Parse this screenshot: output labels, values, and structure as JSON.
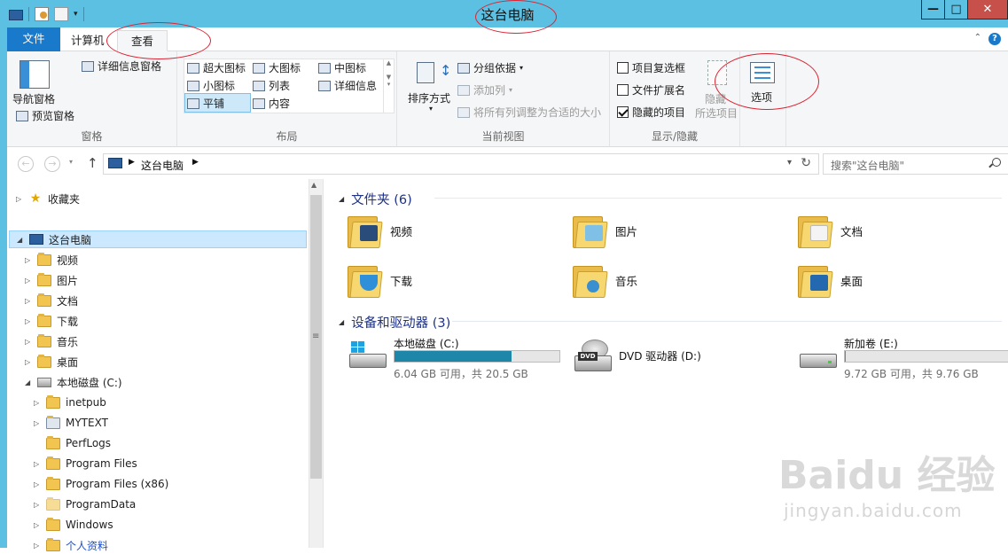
{
  "title": "这台电脑",
  "ribbon_tabs": {
    "file": "文件",
    "computer": "计算机",
    "view": "查看"
  },
  "groups": {
    "panes": {
      "label": "窗格",
      "nav_pane": "导航窗格",
      "preview_pane": "预览窗格",
      "details_pane": "详细信息窗格"
    },
    "layout": {
      "label": "布局",
      "xl_icons": "超大图标",
      "l_icons": "大图标",
      "m_icons": "中图标",
      "s_icons": "小图标",
      "list": "列表",
      "details": "详细信息",
      "tiles": "平铺",
      "content": "内容",
      "selected": "平铺"
    },
    "current_view": {
      "label": "当前视图",
      "sort_by": "排序方式",
      "group_by": "分组依据",
      "add_columns": "添加列",
      "size_all_columns": "将所有列调整为合适的大小"
    },
    "show_hide": {
      "label": "显示/隐藏",
      "item_checkboxes": "项目复选框",
      "file_extensions": "文件扩展名",
      "hidden_items": "隐藏的项目",
      "hide": "隐藏",
      "selected_items": "所选项目"
    },
    "options": {
      "label": "选项"
    }
  },
  "address": {
    "crumb": "这台电脑"
  },
  "search": {
    "placeholder": "搜索\"这台电脑\""
  },
  "nav_tree": {
    "favorites": "收藏夹",
    "this_pc": "这台电脑",
    "children": [
      "视频",
      "图片",
      "文档",
      "下载",
      "音乐",
      "桌面"
    ],
    "local_disk": "本地磁盘 (C:)",
    "c_children": [
      "inetpub",
      "MYTEXT",
      "PerfLogs",
      "Program Files",
      "Program Files (x86)",
      "ProgramData",
      "Windows",
      "个人资料"
    ]
  },
  "folders_section": {
    "title": "文件夹 (6)",
    "items": [
      "视频",
      "图片",
      "文档",
      "下载",
      "音乐",
      "桌面"
    ]
  },
  "devices_section": {
    "title": "设备和驱动器 (3)",
    "drives": [
      {
        "name": "本地磁盘 (C:)",
        "sub": "6.04 GB 可用，共 20.5 GB",
        "used_fraction": 0.71
      },
      {
        "name": "DVD 驱动器 (D:)",
        "sub": ""
      },
      {
        "name": "新加卷 (E:)",
        "sub": "9.72 GB 可用，共 9.76 GB",
        "used_fraction": 0.004
      }
    ]
  },
  "watermark": {
    "brand": "Baidu 经验",
    "url": "jingyan.baidu.com"
  },
  "colors": {
    "accent": "#1979ca",
    "titlebar": "#5bc0e2",
    "annotation": "#dd2233"
  }
}
